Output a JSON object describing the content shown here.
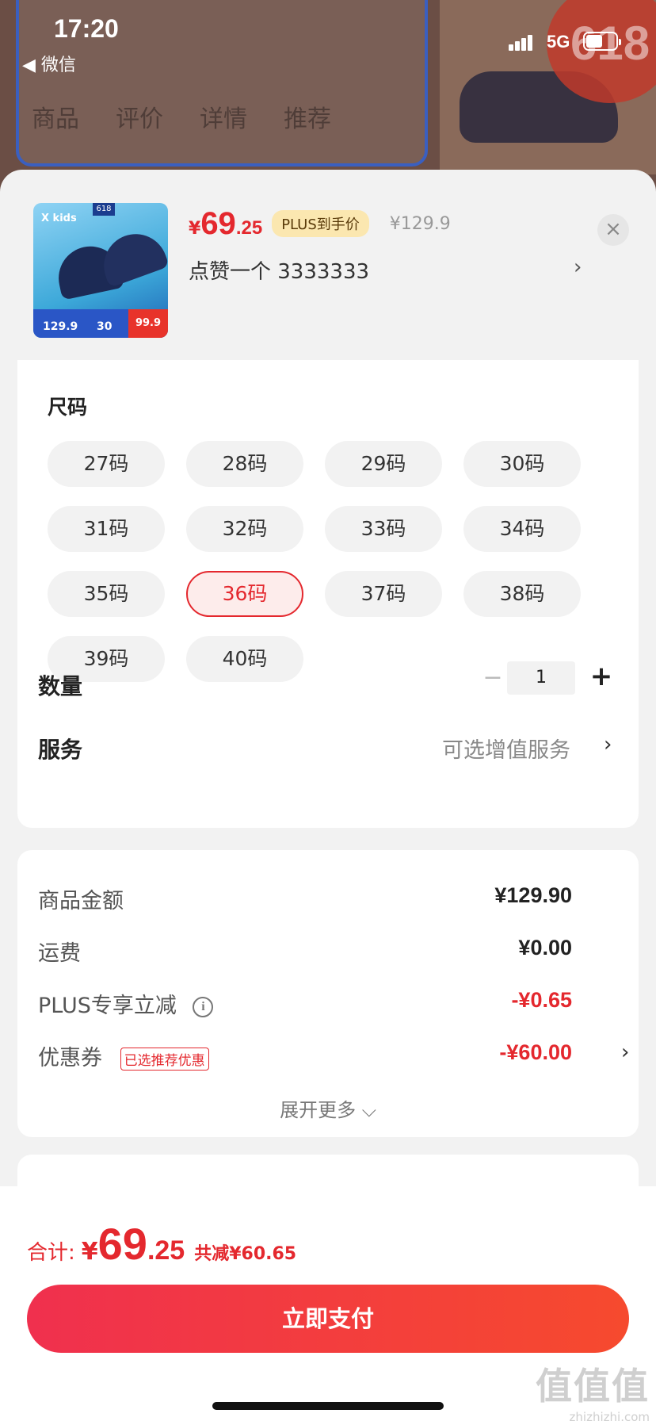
{
  "status_bar": {
    "time": "17:20",
    "back_app": "◀ 微信",
    "network": "5G"
  },
  "background": {
    "tabs": [
      "商品",
      "评价",
      "详情",
      "推荐"
    ],
    "badge": "618"
  },
  "product": {
    "thumb": {
      "brand": "X kids",
      "tag": "618",
      "price_a": "129.9",
      "price_b": "30",
      "price_c": "99.9"
    },
    "price_currency": "¥",
    "price_int": "69",
    "price_dec": ".25",
    "plus_tag": "PLUS到手价",
    "original_price": "¥129.9",
    "spec": "点赞一个  3333333",
    "close_icon": "×",
    "spec_arrow": "›"
  },
  "size_section": {
    "title": "尺码",
    "sizes": [
      "27码",
      "28码",
      "29码",
      "30码",
      "31码",
      "32码",
      "33码",
      "34码",
      "35码",
      "36码",
      "37码",
      "38码",
      "39码",
      "40码"
    ],
    "selected": "36码"
  },
  "quantity": {
    "label": "数量",
    "minus": "−",
    "value": "1",
    "plus": "+"
  },
  "service": {
    "label": "服务",
    "value": "可选增值服务",
    "arrow": "›"
  },
  "price_detail": {
    "goods_label": "商品金额",
    "goods_value": "¥129.90",
    "shipping_label": "运费",
    "shipping_value": "¥0.00",
    "plus_label": "PLUS专享立减",
    "plus_info": "i",
    "plus_value": "-¥0.65",
    "coupon_label": "优惠券",
    "coupon_tag": "已选推荐优惠",
    "coupon_value": "-¥60.00",
    "coupon_arrow": "›",
    "more": "展开更多 ⌵"
  },
  "footer": {
    "total_label": "合计:",
    "total_currency": "¥",
    "total_int": "69",
    "total_dec": ".25",
    "total_save": "共减¥60.65",
    "pay_button": "立即支付"
  },
  "watermark": {
    "big": "值值值",
    "small": "zhizhizhi.com"
  },
  "colors": {
    "accent": "#e4282e",
    "pay_gradient_start": "#f0304e",
    "pay_gradient_end": "#f64a2e",
    "plus_tag_bg": "#fbe7b0"
  }
}
